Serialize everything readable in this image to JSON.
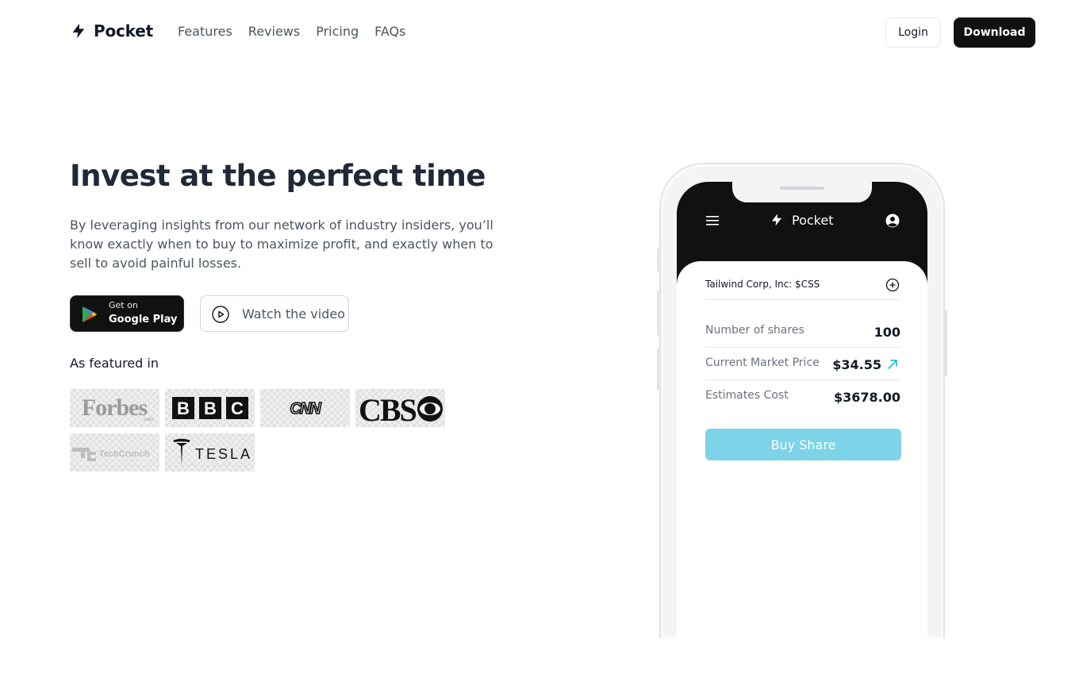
{
  "nav": {
    "brand": "Pocket",
    "links": [
      "Features",
      "Reviews",
      "Pricing",
      "FAQs"
    ],
    "login_label": "Login",
    "download_label": "Download"
  },
  "hero": {
    "title": "Invest at the perfect time",
    "description": "By leveraging insights from our network of industry insiders, you’ll know exactly when to buy to maximize profit, and exactly when to sell to avoid painful losses.",
    "google_play": {
      "small": "Get on",
      "big": "Google Play"
    },
    "watch_video_label": "Watch the video",
    "featured_title": "As featured in",
    "featured_logos": [
      "Forbes",
      "BBC",
      "CNN",
      "CBS",
      "TechCrunch",
      "Tesla"
    ]
  },
  "phone": {
    "app_name": "Pocket",
    "ticker": "Tailwind Corp, Inc: $CSS",
    "rows": [
      {
        "label": "Number of shares",
        "value": "100"
      },
      {
        "label": "Current Market Price",
        "value": "$34.55"
      },
      {
        "label": "Estimates Cost",
        "value": "$3678.00"
      }
    ],
    "buy_label": "Buy Share"
  },
  "colors": {
    "accent_cyan": "#7dd3e8",
    "trend_up": "#06b6d4",
    "dark": "#111111"
  }
}
